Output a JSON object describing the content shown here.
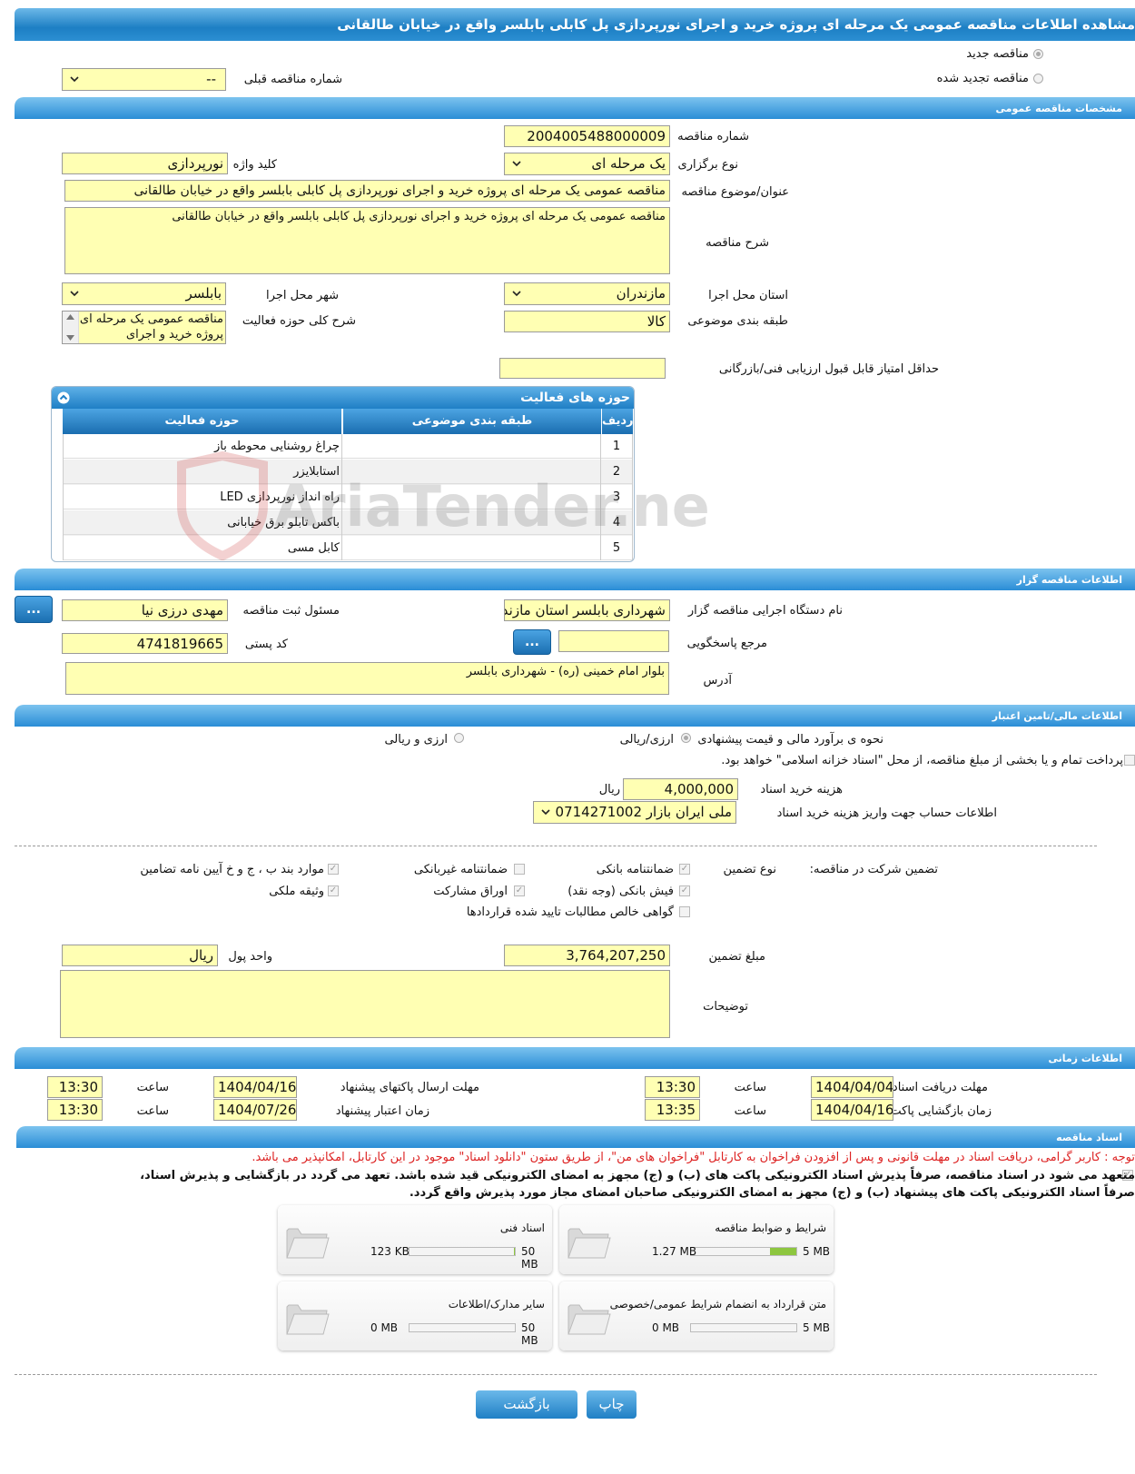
{
  "header": {
    "title": "مشاهده اطلاعات مناقصه عمومی یک مرحله ای پروژه خرید و اجرای نورپردازی پل کابلی بابلسر واقع در خیابان طالقانی"
  },
  "top": {
    "radio_new": "مناقصه جدید",
    "radio_renewed": "مناقصه تجدید شده",
    "prev_number_label": "شماره مناقصه قبلی",
    "prev_number_value": "--"
  },
  "general": {
    "section_title": "مشخصات مناقصه عمومی",
    "number_label": "شماره مناقصه",
    "number_value": "2004005488000009",
    "type_label": "نوع برگزاری",
    "type_value": "یک مرحله ای",
    "keyword_label": "کلید واژه",
    "keyword_value": "نورپردازی",
    "subject_label": "عنوان/موضوع مناقصه",
    "subject_value": "مناقصه عمومی یک مرحله ای پروژه خرید و اجرای نورپردازی پل کابلی بابلسر واقع در خیابان طالقانی",
    "description_label": "شرح مناقصه",
    "description_value": "مناقصه عمومی یک مرحله ای پروژه خرید و اجرای نورپردازی پل کابلی بابلسر واقع در خیابان طالقانی",
    "province_label": "استان محل اجرا",
    "province_value": "مازندران",
    "city_label": "شهر محل اجرا",
    "city_value": "بابلسر",
    "category_label": "طبقه بندی موضوعی",
    "category_value": "کالا",
    "activity_desc_label": "شرح کلی حوزه فعالیت",
    "activity_desc_value": "مناقصه عمومی یک مرحله ای پروژه خرید و اجرای",
    "min_score_label": "حداقل امتیاز قابل قبول ارزیابی فنی/بازرگانی",
    "min_score_value": ""
  },
  "activities": {
    "title": "حوزه های فعالیت",
    "columns": [
      "ردیف",
      "طبقه بندی موضوعی",
      "حوزه فعالیت"
    ],
    "rows": [
      {
        "n": "1",
        "category": "",
        "activity": "چراغ روشنایی محوطه باز"
      },
      {
        "n": "2",
        "category": "",
        "activity": "استابلایزر"
      },
      {
        "n": "3",
        "category": "",
        "activity": "راه انداز نورپردازی LED"
      },
      {
        "n": "4",
        "category": "",
        "activity": "باکس تابلو برق خیابانی"
      },
      {
        "n": "5",
        "category": "",
        "activity": "کابل مسی"
      }
    ],
    "watermark": "AriaTender.neT"
  },
  "organizer": {
    "section_title": "اطلاعات مناقصه گزار",
    "org_label": "نام دستگاه اجرایی مناقصه گزار",
    "org_value": "شهرداری بابلسر استان مازندران",
    "registrar_label": "مسئول ثبت مناقصه",
    "registrar_value": "مهدی درزی نیا",
    "reference_label": "مرجع پاسخگویی",
    "reference_value": "",
    "postal_label": "کد پستی",
    "postal_value": "4741819665",
    "address_label": "آدرس",
    "address_value": "بلوار امام خمینی (ره) - شهرداری بابلسر",
    "dots": "..."
  },
  "finance": {
    "section_title": "اطلاعات مالی/تامین اعتبار",
    "estimate_label": "نحوه ی برآورد مالی و قیمت پیشنهادی",
    "opt_currency": "ارزی/ریالی",
    "opt_currency_rial": "ارزی و ریالی",
    "treasury_text": "پرداخت تمام و یا بخشی از مبلغ مناقصه، از محل \"اسناد خزانه اسلامی\" خواهد بود.",
    "doc_fee_label": "هزینه خرید اسناد",
    "doc_fee_value": "4,000,000",
    "doc_fee_unit": "ریال",
    "account_label": "اطلاعات حساب جهت واریز هزینه خرید اسناد",
    "account_value": "ملی ایران بازار 0714271002"
  },
  "guarantee": {
    "label": "تضمین شرکت در مناقصه:",
    "type_label": "نوع تضمین",
    "options": {
      "bank_guarantee": "ضمانتنامه بانکی",
      "non_bank_guarantee": "ضمانتنامه غیربانکی",
      "clauses": "موارد بند ب ، ج و خ آیین نامه تضامین",
      "bank_receipt": "فیش بانکی (وجه نقد)",
      "bonds": "اوراق مشارکت",
      "property": "وثیقه ملکی",
      "certificate": "گواهی خالص مطالبات تایید شده قراردادها"
    },
    "amount_label": "مبلغ تضمین",
    "amount_value": "3,764,207,250",
    "currency_label": "واحد پول",
    "currency_value": "ریال",
    "notes_label": "توضیحات",
    "notes_value": ""
  },
  "timing": {
    "section_title": "اطلاعات زمانی",
    "receive_label": "مهلت دریافت اسناد",
    "receive_date": "1404/04/04",
    "receive_time": "13:30",
    "send_label": "مهلت ارسال پاکتهای پیشنهاد",
    "send_date": "1404/04/16",
    "send_time": "13:30",
    "open_label": "زمان بازگشایی پاکت ها",
    "open_date": "1404/04/16",
    "open_time": "13:35",
    "validity_label": "زمان اعتبار پیشنهاد",
    "validity_date": "1404/07/26",
    "validity_time": "13:30",
    "time_label": "ساعت"
  },
  "docs": {
    "section_title": "اسناد مناقصه",
    "notice_red": "توجه : کاربر گرامی، دریافت اسناد در مهلت قانونی و پس از افزودن فراخوان به کارتابل \"فراخوان های من\"، از طریق ستون \"دانلود اسناد\" موجود در این کارتابل، امکانپذیر می باشد.",
    "commit_line1": "متعهد می شود در اسناد مناقصه، صرفاً پذیرش اسناد الکترونیکی پاکت های (ب) و (ج) مجهز به امضای الکترونیکی قید شده باشد. تعهد می گردد در بازگشایی و پذیرش اسناد،",
    "commit_line2": "صرفاً اسناد الکترونیکی پاکت های پیشنهاد (ب) و (ج) مجهز به امضای الکترونیکی صاحبان امضای مجاز مورد پذیرش واقع گردد.",
    "cards": [
      {
        "name": "شرایط و ضوابط مناقصه",
        "size": "1.27 MB",
        "max": "5 MB",
        "fill": 0.254
      },
      {
        "name": "اسناد فنی",
        "size": "123 KB",
        "max": "50 MB",
        "fill": 0.0025
      },
      {
        "name": "متن قرارداد به انضمام شرایط عمومی/خصوصی",
        "size": "0 MB",
        "max": "5 MB",
        "fill": 0
      },
      {
        "name": "سایر مدارک/اطلاعات",
        "size": "0 MB",
        "max": "50 MB",
        "fill": 0
      }
    ]
  },
  "footer": {
    "print": "چاپ",
    "back": "بازگشت"
  }
}
